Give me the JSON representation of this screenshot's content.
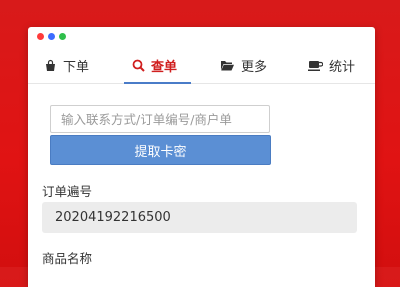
{
  "window": {
    "controls": [
      "close",
      "minimize",
      "maximize"
    ]
  },
  "tabs": [
    {
      "label": "下单",
      "icon": "shopping-bag-icon"
    },
    {
      "label": "查单",
      "icon": "search-icon",
      "active": true
    },
    {
      "label": "更多",
      "icon": "folder-open-icon"
    },
    {
      "label": "统计",
      "icon": "coffee-cup-icon"
    }
  ],
  "search": {
    "placeholder": "输入联系方式/订单编号/商户单"
  },
  "actions": {
    "fetch_label": "提取卡密"
  },
  "order": {
    "label": "订单遍号",
    "value": "20204192216500"
  },
  "product": {
    "label": "商品名称"
  },
  "colors": {
    "background": "#e01313",
    "accent_active_tab": "#d01f1f",
    "tab_underline": "#4a7cc8",
    "button": "#5b8fd4",
    "readonly_field": "#ececec"
  }
}
